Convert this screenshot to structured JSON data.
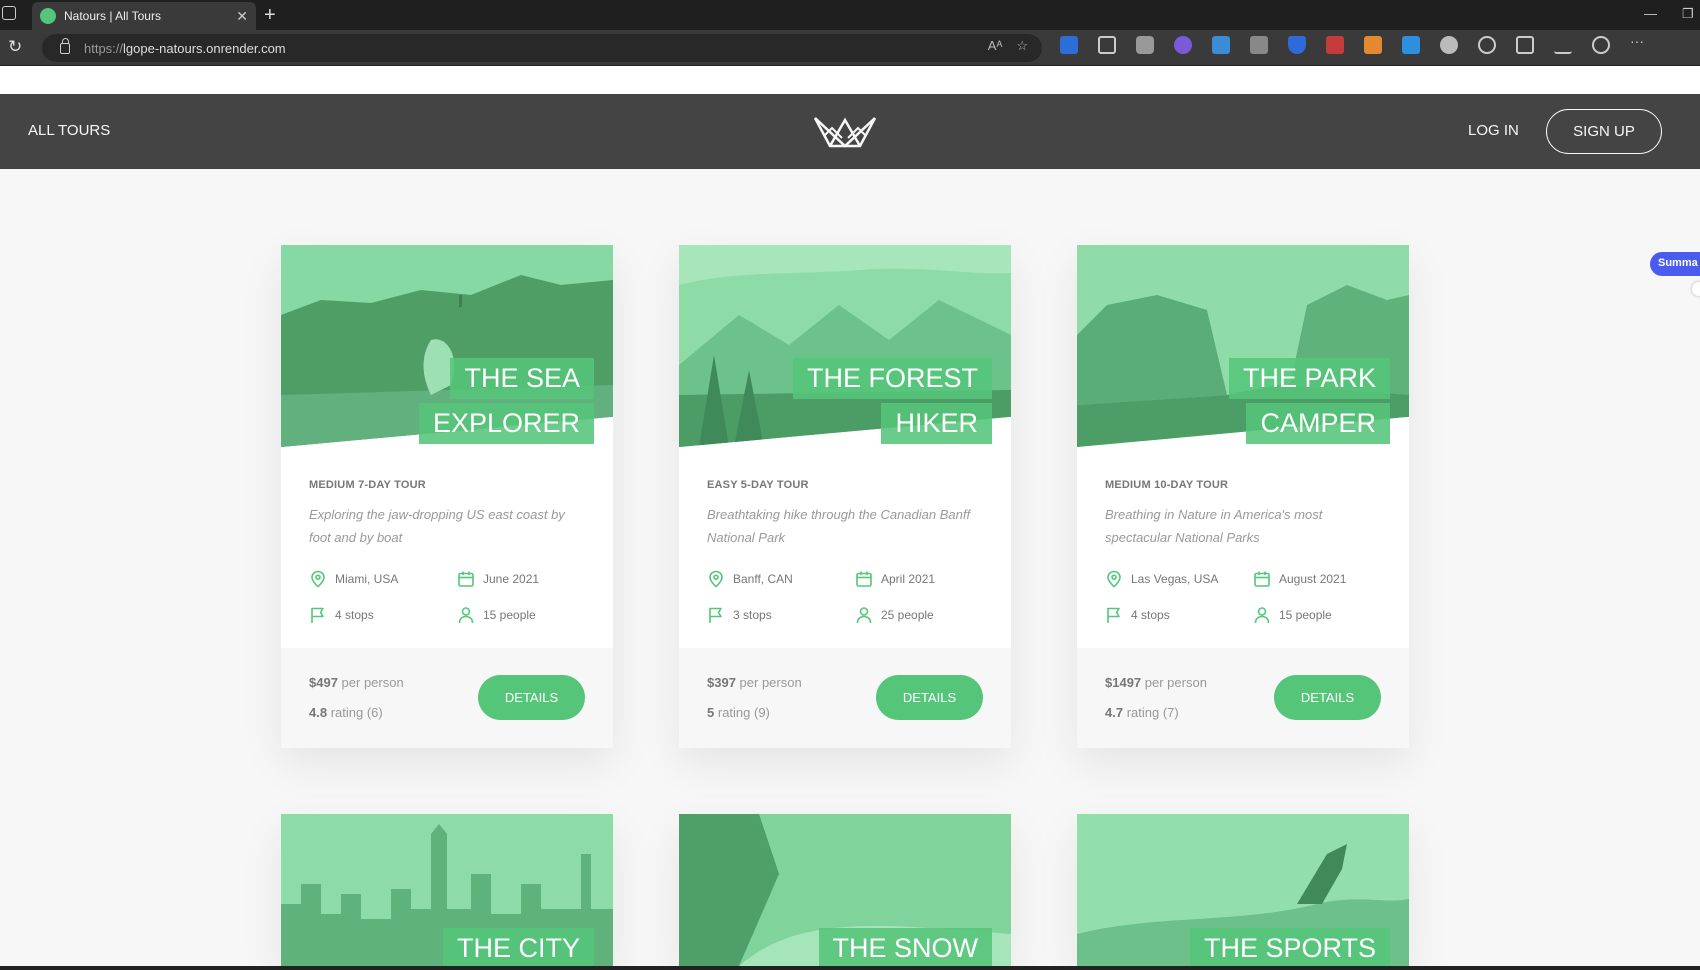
{
  "browser": {
    "tab_title": "Natours | All Tours",
    "url_proto": "https://",
    "url_host": "lgope-natours.onrender.com"
  },
  "header": {
    "nav_all": "ALL TOURS",
    "login": "LOG IN",
    "signup": "SIGN UP"
  },
  "summarize_label": "Summa",
  "colors": {
    "brand": "#55c57a",
    "header": "#444444"
  },
  "cards": [
    {
      "heading": [
        "THE SEA",
        "EXPLORER"
      ],
      "subheading": "MEDIUM 7-DAY TOUR",
      "summary": "Exploring the jaw-dropping US east coast by foot and by boat",
      "location": "Miami, USA",
      "date": "June 2021",
      "stops": "4 stops",
      "people": "15 people",
      "price": "$497",
      "price_suffix": "per person",
      "rating": "4.8",
      "rating_suffix": "rating (6)",
      "button": "DETAILS"
    },
    {
      "heading": [
        "THE FOREST",
        "HIKER"
      ],
      "subheading": "EASY 5-DAY TOUR",
      "summary": "Breathtaking hike through the Canadian Banff National Park",
      "location": "Banff, CAN",
      "date": "April 2021",
      "stops": "3 stops",
      "people": "25 people",
      "price": "$397",
      "price_suffix": "per person",
      "rating": "5",
      "rating_suffix": "rating (9)",
      "button": "DETAILS"
    },
    {
      "heading": [
        "THE PARK",
        "CAMPER"
      ],
      "subheading": "MEDIUM 10-DAY TOUR",
      "summary": "Breathing in Nature in America's most spectacular National Parks",
      "location": "Las Vegas, USA",
      "date": "August 2021",
      "stops": "4 stops",
      "people": "15 people",
      "price": "$1497",
      "price_suffix": "per person",
      "rating": "4.7",
      "rating_suffix": "rating (7)",
      "button": "DETAILS"
    },
    {
      "heading": [
        "THE CITY"
      ]
    },
    {
      "heading": [
        "THE SNOW"
      ]
    },
    {
      "heading": [
        "THE SPORTS"
      ]
    }
  ]
}
